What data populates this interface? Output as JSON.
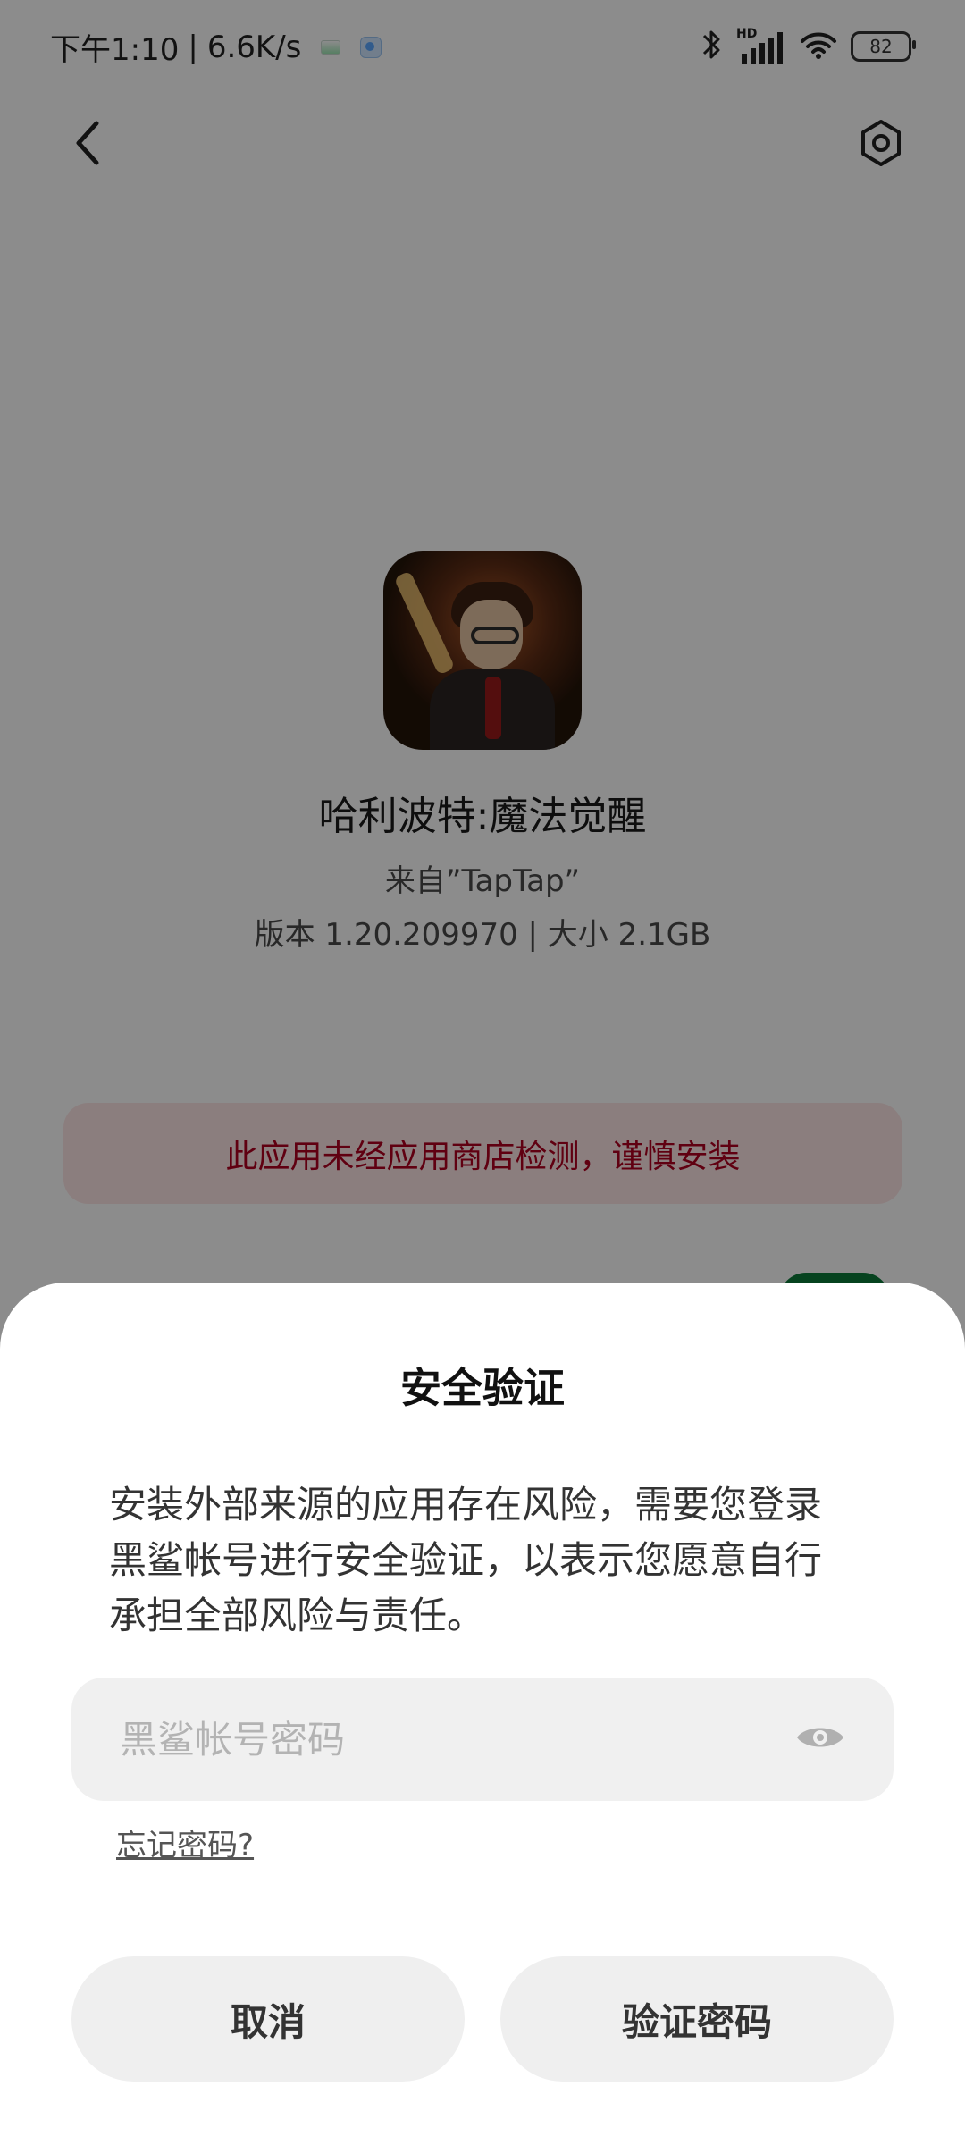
{
  "status_bar": {
    "time": "下午1:10",
    "speed": "6.6K/s",
    "battery": "82",
    "signal_label": "HD"
  },
  "app": {
    "name": "哈利波特:魔法觉醒",
    "source": "来自”TapTap”",
    "meta": "版本 1.20.209970 | 大小 2.1GB",
    "warning": "此应用未经应用商店检测，谨慎安装"
  },
  "dialog": {
    "title": "安全验证",
    "body": "安装外部来源的应用存在风险，需要您登录黑鲨帐号进行安全验证，以表示您愿意自行承担全部风险与责任。",
    "password_placeholder": "黑鲨帐号密码",
    "password_value": "",
    "forgot": "忘记密码?",
    "cancel": "取消",
    "verify": "验证密码"
  },
  "icons": {
    "back": "chevron-left-icon",
    "settings": "hex-gear-icon",
    "eye": "eye-icon",
    "bluetooth": "bluetooth-icon",
    "signal": "signal-icon",
    "wifi": "wifi-icon",
    "battery": "battery-icon"
  },
  "colors": {
    "overlay": "#00000073",
    "warning_bg": "#fde6e6",
    "warning_text": "#b00020",
    "button_bg": "#efefef",
    "field_bg": "#f0f0f0"
  }
}
